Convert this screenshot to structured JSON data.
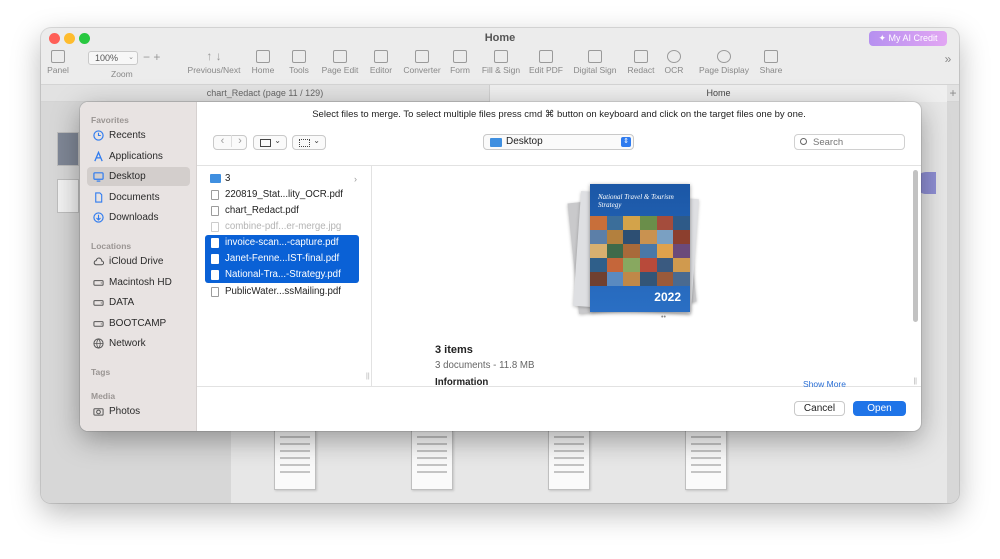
{
  "app": {
    "title": "Home",
    "credit_button": "My AI Credit",
    "zoom_value": "100%",
    "zoom_label": "Zoom",
    "document_tab": "chart_Redact (page 11 / 129)",
    "home_tab": "Home",
    "toolbar": [
      {
        "label": "Panel",
        "icon": "panel-icon"
      },
      {
        "label": "Previous/Next",
        "icon": "arrows-icon"
      },
      {
        "label": "Home",
        "icon": "home-icon"
      },
      {
        "label": "Tools",
        "icon": "toolbox-icon"
      },
      {
        "label": "Page Edit",
        "icon": "page-edit-icon"
      },
      {
        "label": "Editor",
        "icon": "editor-icon"
      },
      {
        "label": "Converter",
        "icon": "converter-icon"
      },
      {
        "label": "Form",
        "icon": "form-icon"
      },
      {
        "label": "Fill & Sign",
        "icon": "fill-sign-icon"
      },
      {
        "label": "Edit PDF",
        "icon": "edit-pdf-icon"
      },
      {
        "label": "Digital Sign",
        "icon": "digital-sign-icon"
      },
      {
        "label": "Redact",
        "icon": "redact-icon"
      },
      {
        "label": "OCR",
        "icon": "ocr-icon"
      },
      {
        "label": "Page Display",
        "icon": "page-display-icon"
      },
      {
        "label": "Share",
        "icon": "share-icon"
      }
    ]
  },
  "dialog": {
    "prompt": "Select files to merge. To select multiple files press cmd ⌘ button on keyboard and click on the target files one by one.",
    "sidebar": {
      "favorites_title": "Favorites",
      "favorites": [
        {
          "label": "Recents",
          "icon": "clock-icon"
        },
        {
          "label": "Applications",
          "icon": "applications-icon"
        },
        {
          "label": "Desktop",
          "icon": "desktop-icon"
        },
        {
          "label": "Documents",
          "icon": "document-icon"
        },
        {
          "label": "Downloads",
          "icon": "download-icon"
        }
      ],
      "locations_title": "Locations",
      "locations": [
        {
          "label": "iCloud Drive",
          "icon": "cloud-icon"
        },
        {
          "label": "Macintosh HD",
          "icon": "disk-icon"
        },
        {
          "label": "DATA",
          "icon": "disk-icon"
        },
        {
          "label": "BOOTCAMP",
          "icon": "disk-icon"
        },
        {
          "label": "Network",
          "icon": "network-icon"
        }
      ],
      "tags_title": "Tags",
      "media_title": "Media",
      "media": [
        {
          "label": "Photos",
          "icon": "camera-icon"
        }
      ],
      "selected": "Desktop"
    },
    "location": "Desktop",
    "search_placeholder": "Search",
    "files": [
      {
        "name": "3",
        "type": "folder"
      },
      {
        "name": "220819_Stat...lity_OCR.pdf",
        "type": "file"
      },
      {
        "name": "chart_Redact.pdf",
        "type": "file"
      },
      {
        "name": "combine-pdf...er-merge.jpg",
        "type": "file"
      },
      {
        "name": "invoice-scan...-capture.pdf",
        "type": "file"
      },
      {
        "name": "Janet-Fenne...IST-final.pdf",
        "type": "file"
      },
      {
        "name": "National-Tra...-Strategy.pdf",
        "type": "file"
      },
      {
        "name": "PublicWater...ssMailing.pdf",
        "type": "file"
      }
    ],
    "preview": {
      "cover_title": "National Travel & Tourism Strategy",
      "cover_year": "2022",
      "items_count": "3 items",
      "items_detail": "3 documents - 11.8 MB",
      "information_label": "Information",
      "show_more": "Show More"
    },
    "cancel_label": "Cancel",
    "open_label": "Open"
  }
}
